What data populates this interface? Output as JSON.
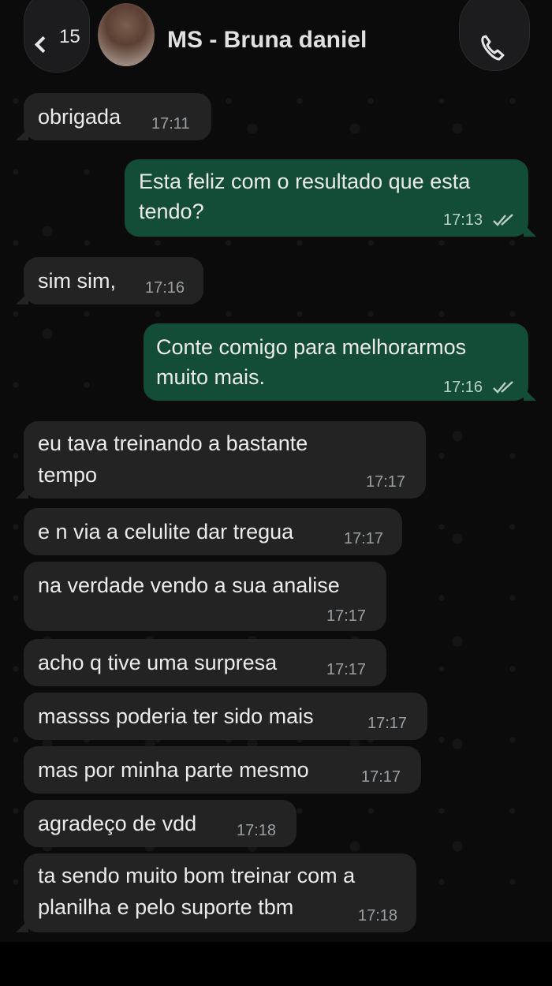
{
  "header": {
    "back_icon": "chevron-left-icon",
    "unread_count": "15",
    "contact_name": "MS - Bruna daniel",
    "call_icon": "phone-icon"
  },
  "colors": {
    "incoming_bubble": "#232323",
    "outgoing_bubble": "#144d37",
    "chat_background": "#0b0b0b",
    "read_ticks": "#b9cfc4"
  },
  "messages": [
    {
      "direction": "in",
      "lines": [
        "obrigada"
      ],
      "time": "17:11"
    },
    {
      "direction": "out",
      "lines": [
        "Esta feliz com o resultado que esta",
        "tendo?"
      ],
      "time": "17:13",
      "status": "read"
    },
    {
      "direction": "in",
      "lines": [
        "sim sim,"
      ],
      "time": "17:16"
    },
    {
      "direction": "out",
      "lines": [
        "Conte comigo para melhorarmos",
        "muito mais."
      ],
      "time": "17:16",
      "status": "read"
    },
    {
      "direction": "in",
      "lines": [
        "eu tava treinando a bastante",
        "tempo"
      ],
      "time": "17:17"
    },
    {
      "direction": "in",
      "lines": [
        "e n via a celulite dar tregua"
      ],
      "time": "17:17"
    },
    {
      "direction": "in",
      "lines": [
        "na verdade vendo a sua analise"
      ],
      "time": "17:17"
    },
    {
      "direction": "in",
      "lines": [
        "acho q tive uma surpresa"
      ],
      "time": "17:17"
    },
    {
      "direction": "in",
      "lines": [
        "massss poderia ter sido mais"
      ],
      "time": "17:17"
    },
    {
      "direction": "in",
      "lines": [
        "mas por minha parte mesmo"
      ],
      "time": "17:17"
    },
    {
      "direction": "in",
      "lines": [
        "agradeço de vdd"
      ],
      "time": "17:18"
    },
    {
      "direction": "in",
      "lines": [
        "ta sendo muito bom treinar com a",
        "planilha e pelo suporte tbm"
      ],
      "time": "17:18"
    }
  ]
}
